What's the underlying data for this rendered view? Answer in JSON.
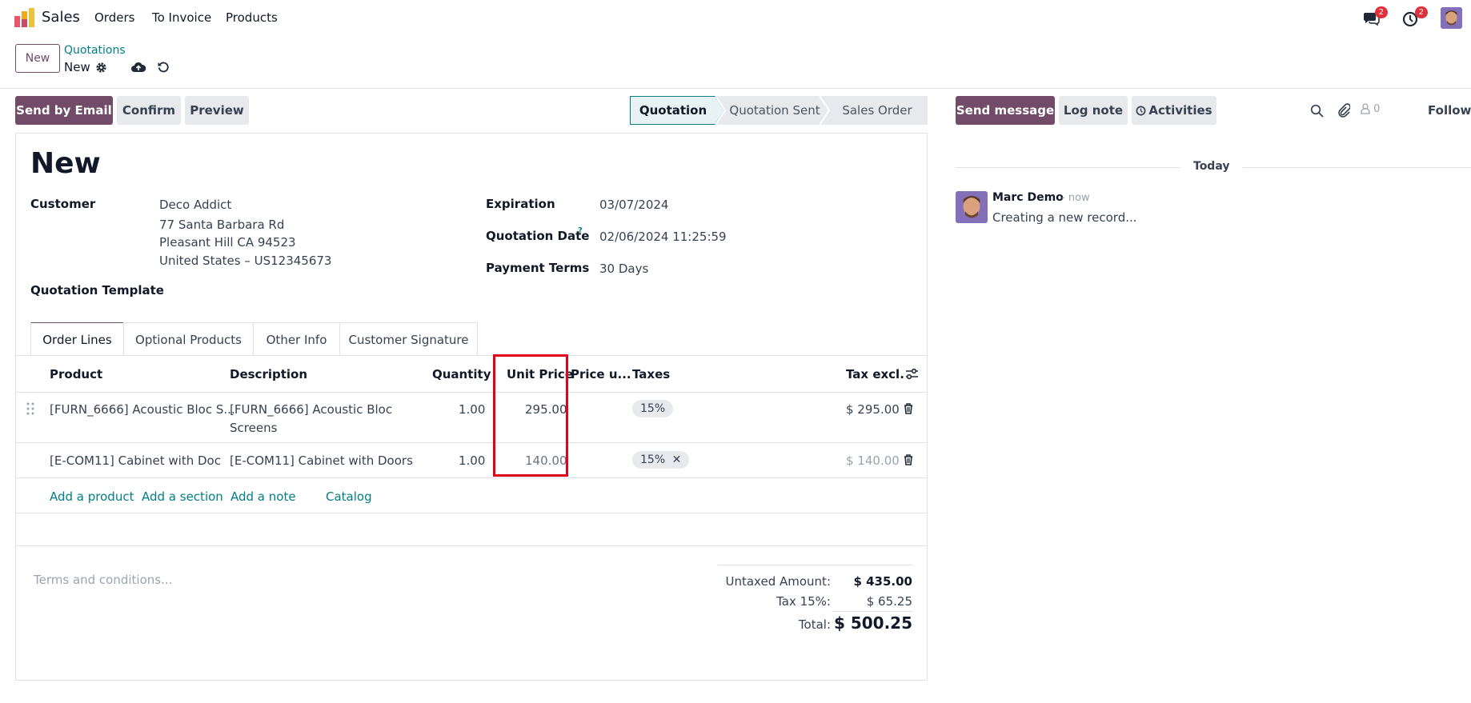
{
  "navbar": {
    "app_name": "Sales",
    "menu": [
      "Orders",
      "To Invoice",
      "Products"
    ],
    "messages_badge": "2",
    "activities_badge": "2"
  },
  "control_panel": {
    "new_button": "New",
    "breadcrumb_parent": "Quotations",
    "breadcrumb_current": "New"
  },
  "actions": {
    "send_by_email": "Send by Email",
    "confirm": "Confirm",
    "preview": "Preview"
  },
  "status": {
    "steps": [
      "Quotation",
      "Quotation Sent",
      "Sales Order"
    ],
    "active": "Quotation"
  },
  "form": {
    "title": "New",
    "customer_label": "Customer",
    "customer_name": "Deco Addict",
    "customer_address_1": "77 Santa Barbara Rd",
    "customer_address_2": "Pleasant Hill CA 94523",
    "customer_address_3": "United States – US12345673",
    "quotation_template_label": "Quotation Template",
    "expiration_label": "Expiration",
    "expiration_value": "03/07/2024",
    "quotation_date_label": "Quotation Date",
    "quotation_date_help": "?",
    "quotation_date_value": "02/06/2024 11:25:59",
    "payment_terms_label": "Payment Terms",
    "payment_terms_value": "30 Days"
  },
  "tabs": [
    "Order Lines",
    "Optional Products",
    "Other Info",
    "Customer Signature"
  ],
  "order_lines": {
    "columns": {
      "product": "Product",
      "description": "Description",
      "quantity": "Quantity",
      "unit_price": "Unit Price",
      "price_unit_short": "Price u...",
      "taxes": "Taxes",
      "tax_excl": "Tax excl."
    },
    "rows": [
      {
        "product": "[FURN_6666] Acoustic Bloc S...",
        "description_1": "[FURN_6666] Acoustic Bloc",
        "description_2": "Screens",
        "quantity": "1.00",
        "unit_price": "295.00",
        "tax": "15%",
        "subtotal": "$ 295.00"
      },
      {
        "product": "[E-COM11] Cabinet with Doc",
        "description_1": "[E-COM11] Cabinet with Doors",
        "quantity": "1.00",
        "unit_price": "140.00",
        "tax": "15%",
        "tax_remove": "✕",
        "subtotal": "$ 140.00"
      }
    ],
    "add_product": "Add a product",
    "add_section": "Add a section",
    "add_note": "Add a note",
    "catalog": "Catalog"
  },
  "footer": {
    "terms_placeholder": "Terms and conditions...",
    "untaxed_label": "Untaxed Amount:",
    "untaxed_value": "$ 435.00",
    "tax_label": "Tax 15%:",
    "tax_value": "$ 65.25",
    "total_label": "Total:",
    "total_value": "$ 500.25"
  },
  "chatter": {
    "send_message": "Send message",
    "log_note": "Log note",
    "activities": "Activities",
    "followers_count": "0",
    "follow": "Follow",
    "date_separator": "Today",
    "message_author": "Marc Demo",
    "message_time": "- now",
    "message_body": "Creating a new record..."
  },
  "colors": {
    "brand": "#714b67",
    "link": "#017e84",
    "highlight": "#e2001a",
    "badge": "#e0303a"
  }
}
